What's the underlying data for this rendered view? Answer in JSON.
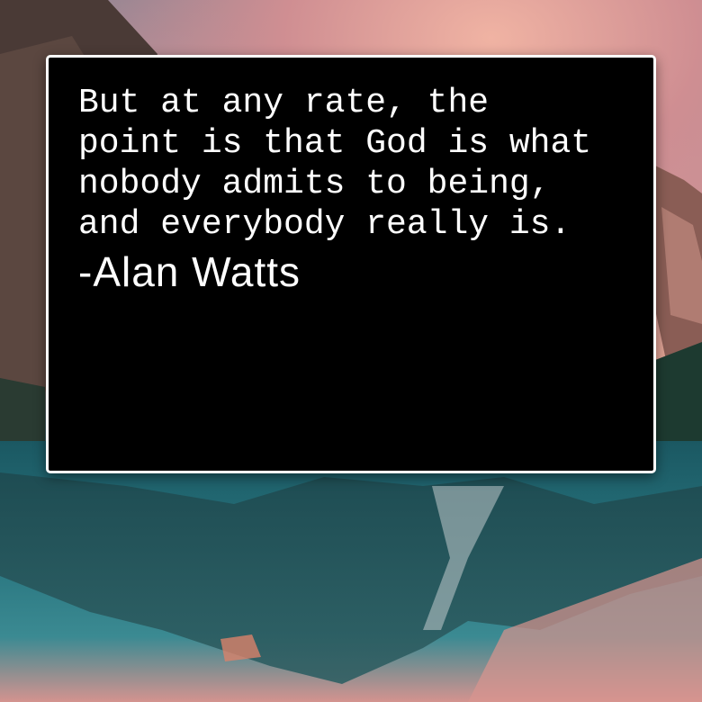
{
  "quote": {
    "lines": [
      "But at any rate, the",
      "point is that God is what",
      "nobody admits to being,",
      "and everybody really is."
    ],
    "author": "-Alan Watts"
  },
  "colors": {
    "card_background": "#000000",
    "card_border": "#ffffff",
    "text": "#ffffff"
  },
  "background": {
    "description_icon": "mountain-lake-photo"
  }
}
